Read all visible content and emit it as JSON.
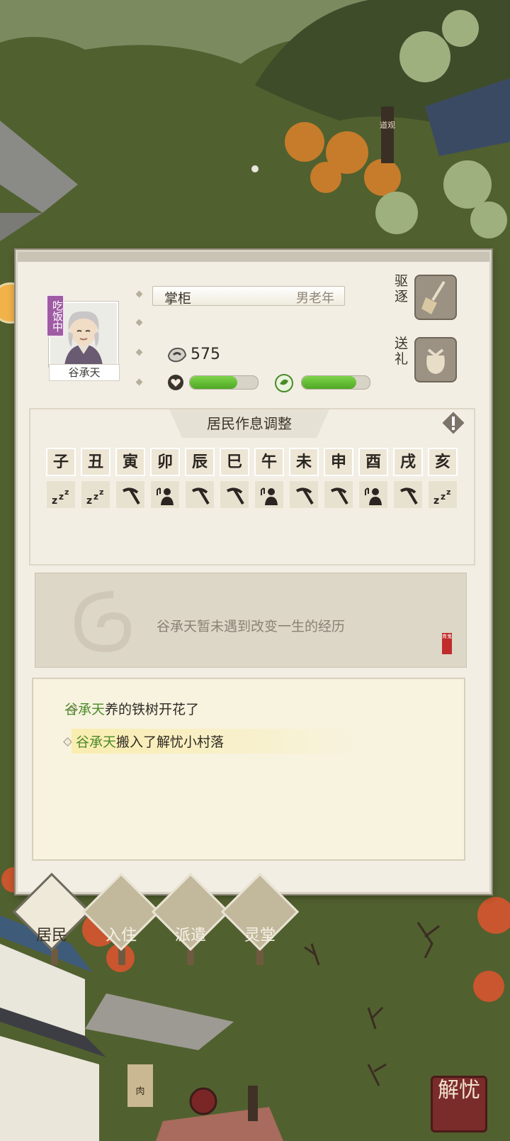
{
  "profile": {
    "status_badge": "吃饭中",
    "name": "谷承天",
    "role": "掌柜",
    "sex_age": "男老年",
    "coins": "575",
    "health_level": 0.7,
    "mood_level": 0.8
  },
  "side_actions": {
    "expel_label": "驱逐",
    "gift_label": "送礼"
  },
  "schedule": {
    "title": "居民作息调整",
    "hours": [
      "子",
      "丑",
      "寅",
      "卯",
      "辰",
      "巳",
      "午",
      "未",
      "申",
      "酉",
      "戌",
      "亥"
    ],
    "activities": [
      "sleep",
      "sleep",
      "work",
      "leisure",
      "work",
      "work",
      "leisure",
      "work",
      "work",
      "leisure",
      "work",
      "sleep"
    ]
  },
  "experience": {
    "text": "谷承天暂未遇到改变一生的经历",
    "seal_text": "育鬼"
  },
  "log": [
    {
      "name": "谷承天",
      "text": "养的铁树开花了"
    },
    {
      "name": "谷承天",
      "text": "搬入了解忧小村落"
    }
  ],
  "tabs": [
    {
      "label": "居民",
      "active": true
    },
    {
      "label": "入住",
      "active": false
    },
    {
      "label": "派遣",
      "active": false
    },
    {
      "label": "灵堂",
      "active": false
    }
  ],
  "scenery": {
    "signpost": "道观",
    "shop_sign": "肉",
    "corner_button": "解忧"
  }
}
